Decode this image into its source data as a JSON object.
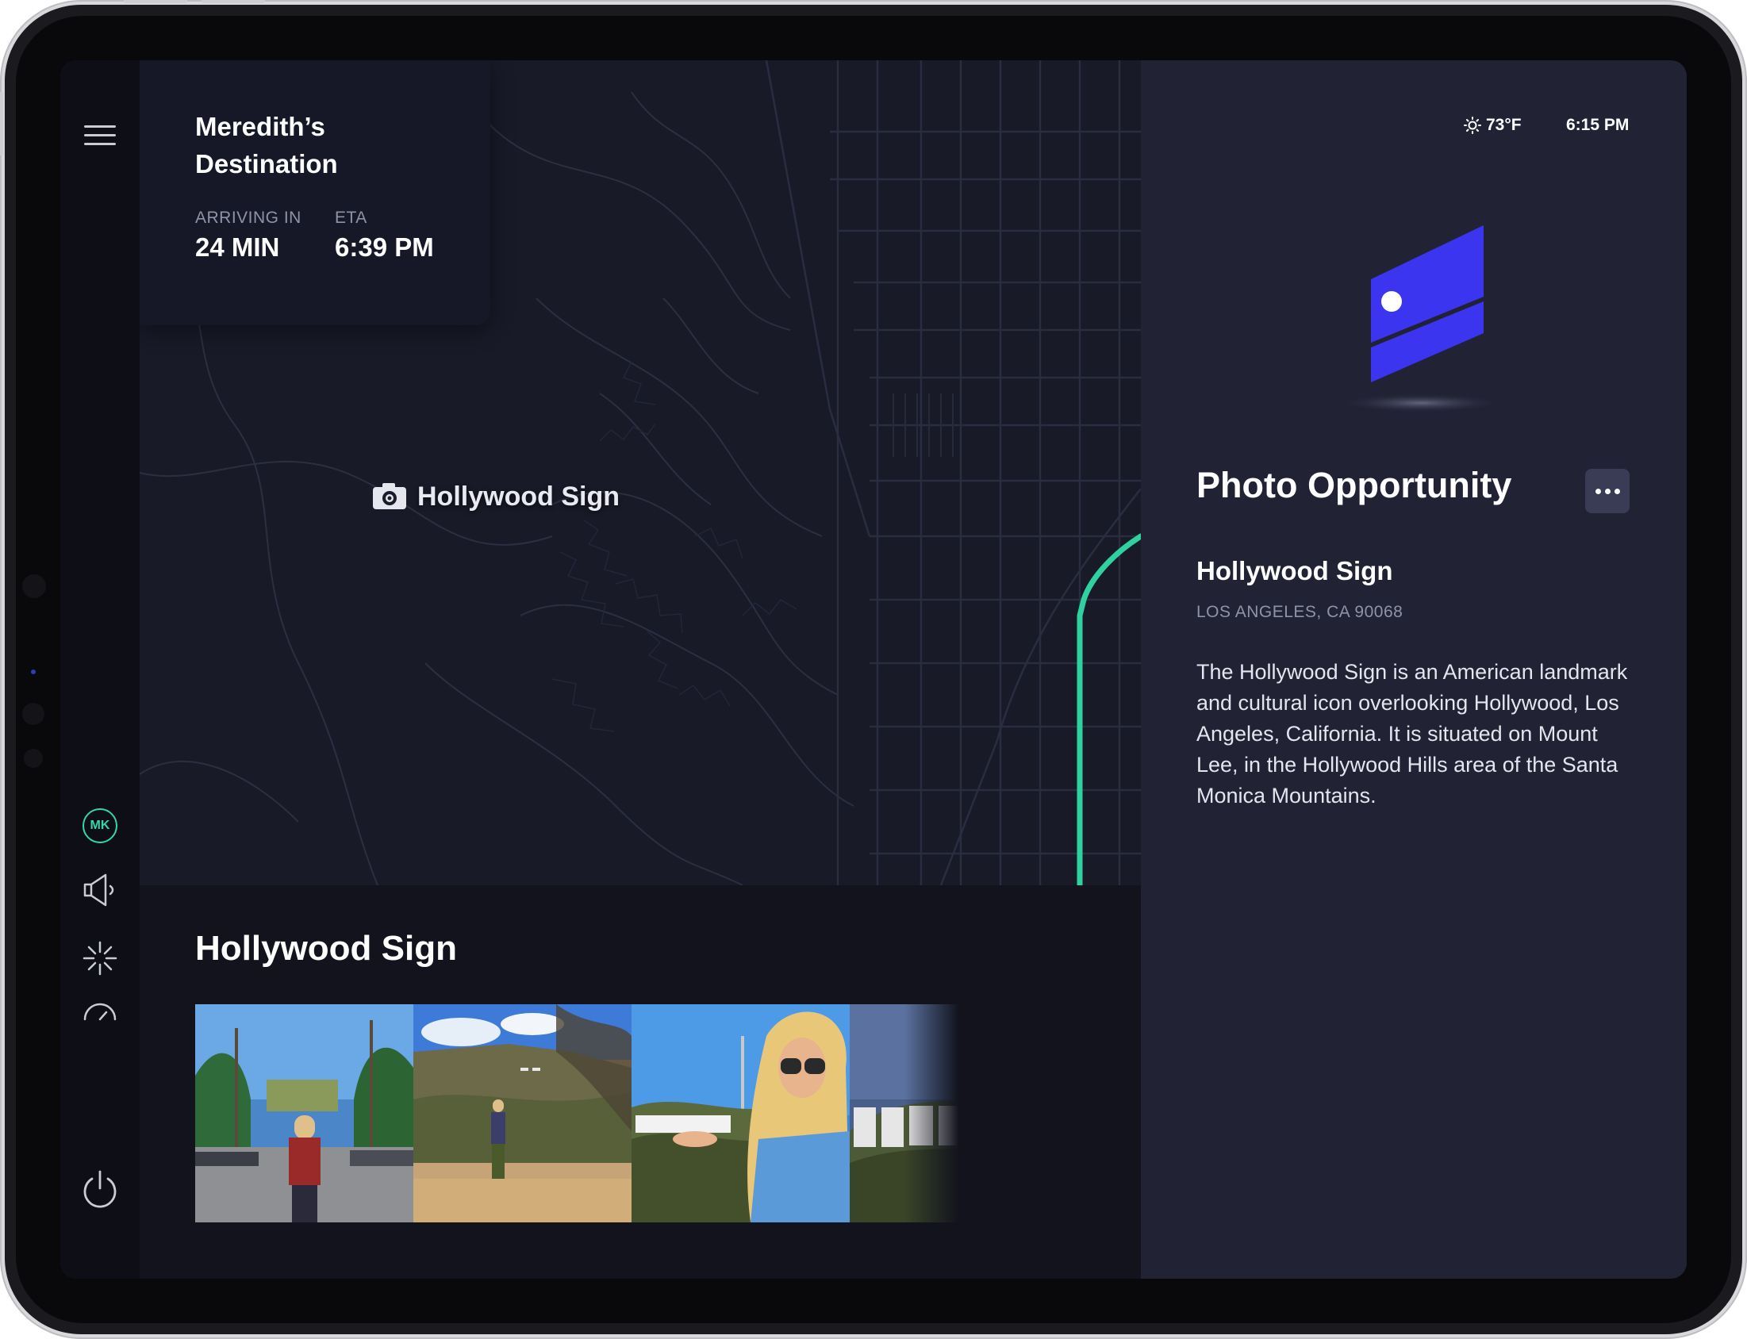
{
  "trip": {
    "title": "Meredith’s Destination",
    "arriving_label": "ARRIVING IN",
    "arriving_value": "24 MIN",
    "eta_label": "ETA",
    "eta_value": "6:39 PM"
  },
  "map": {
    "marker_icon": "camera-icon",
    "marker_label": "Hollywood Sign",
    "route_color": "#2fd1a0"
  },
  "rail": {
    "items": [
      {
        "icon": "menu-icon"
      },
      {
        "avatar_initials": "MK"
      },
      {
        "icon": "speaker-icon"
      },
      {
        "icon": "fan-icon"
      },
      {
        "icon": "gauge-icon"
      },
      {
        "icon": "power-icon"
      }
    ]
  },
  "gallery": {
    "title": "Hollywood Sign",
    "photos": [
      {
        "alt": "street-photo"
      },
      {
        "alt": "hillside-photo"
      },
      {
        "alt": "sign-selfie-photo"
      },
      {
        "alt": "sign-closeup-photo"
      }
    ]
  },
  "status": {
    "weather_icon": "sun-icon",
    "temperature": "73°F",
    "time": "6:15 PM"
  },
  "panel": {
    "heading": "Photo Opportunity",
    "more_icon": "more-icon",
    "place_name": "Hollywood Sign",
    "place_address": "LOS ANGELES, CA 90068",
    "description": "The Hollywood Sign is an American landmark and cultural icon overlooking Hollywood, Los Angeles, California. It is situated on Mount Lee, in the Hollywood Hills area of the Santa Monica Mountains."
  },
  "colors": {
    "accent": "#3b35f0",
    "avatar": "#35d6a9",
    "panel_bg": "#212234"
  }
}
